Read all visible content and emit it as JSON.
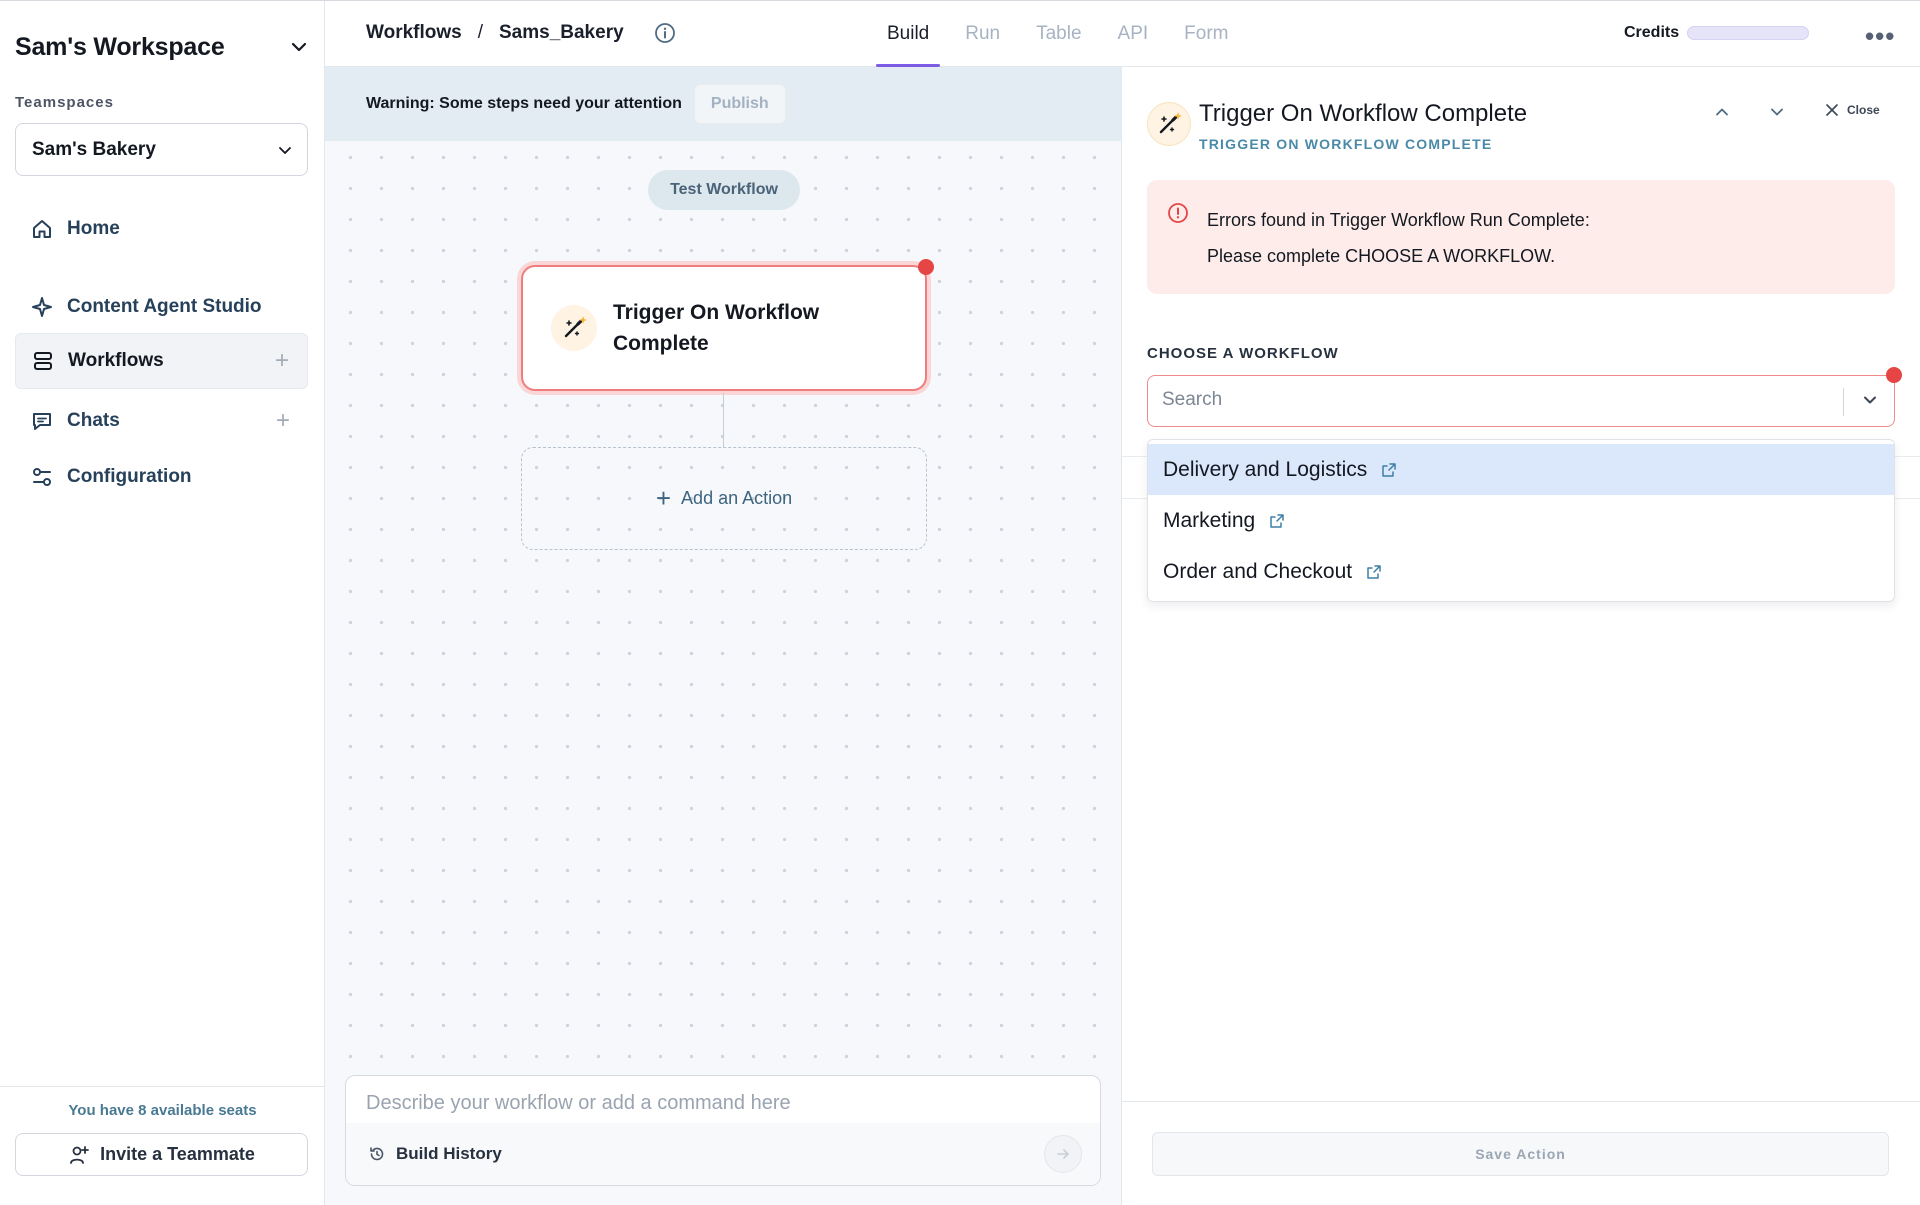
{
  "sidebar": {
    "workspace_title": "Sam's Workspace",
    "teamspaces_label": "Teamspaces",
    "team_selected": "Sam's Bakery",
    "nav": {
      "home": "Home",
      "content_agent_studio": "Content Agent Studio",
      "workflows": "Workflows",
      "chats": "Chats",
      "configuration": "Configuration"
    },
    "plus": "+",
    "seats_text": "You have 8 available seats",
    "invite_label": "Invite a Teammate"
  },
  "topbar": {
    "breadcrumb_root": "Workflows",
    "breadcrumb_sep": "/",
    "breadcrumb_current": "Sams_Bakery",
    "tabs": [
      "Build",
      "Run",
      "Table",
      "API",
      "Form"
    ],
    "active_tab": "Build",
    "credits_label": "Credits",
    "more": "•••"
  },
  "canvas": {
    "warning_text": "Warning: Some steps need your attention",
    "publish_label": "Publish",
    "test_workflow_label": "Test Workflow",
    "node_title": "Trigger On Workflow Complete",
    "add_action_label": "Add an Action",
    "add_action_plus": "+",
    "composer_placeholder": "Describe your workflow or add a command here",
    "build_history_label": "Build History"
  },
  "panel": {
    "title": "Trigger On Workflow Complete",
    "subtitle": "TRIGGER ON WORKFLOW COMPLETE",
    "close_label": "Close",
    "error_line1": "Errors found in Trigger Workflow Run Complete:",
    "error_line2": "Please complete CHOOSE A WORKFLOW.",
    "field_label": "CHOOSE A WORKFLOW",
    "search_placeholder": "Search",
    "options": [
      "Delivery and Logistics",
      "Marketing",
      "Order and Checkout"
    ],
    "highlighted_option": "Delivery and Logistics",
    "save_label": "Save Action"
  },
  "colors": {
    "accent_tab": "#7c5ce4",
    "error": "#e64545",
    "error_bg": "#fdecea",
    "highlight": "#dbe8fb"
  },
  "icons": {
    "workspace_chevron": "chevron-down-icon",
    "home": "home-icon",
    "content_agent_studio": "sparkle-icon",
    "workflows": "workflow-icon",
    "chats": "chat-icon",
    "configuration": "sliders-icon",
    "invite": "user-plus-icon",
    "info": "info-icon",
    "trigger": "magic-wand-icon",
    "history": "history-icon",
    "external_link": "external-link-icon"
  }
}
